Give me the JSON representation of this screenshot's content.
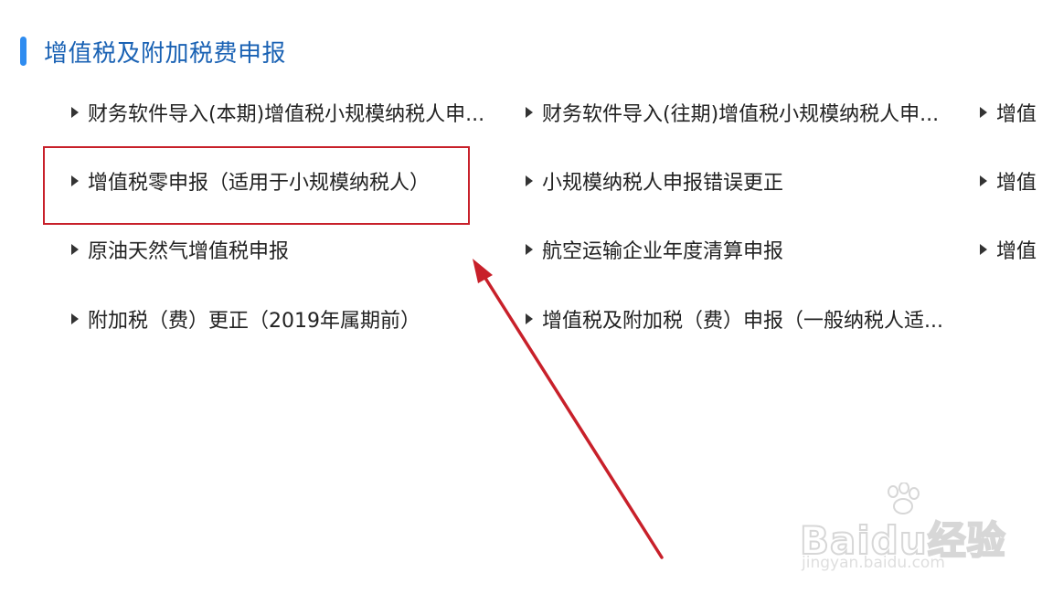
{
  "section": {
    "title": "增值税及附加税费申报"
  },
  "links": [
    {
      "label": "财务软件导入(本期)增值税小规模纳税人申..."
    },
    {
      "label": "财务软件导入(往期)增值税小规模纳税人申..."
    },
    {
      "label": "增值"
    },
    {
      "label": "增值税零申报（适用于小规模纳税人）"
    },
    {
      "label": "小规模纳税人申报错误更正"
    },
    {
      "label": "增值"
    },
    {
      "label": "原油天然气增值税申报"
    },
    {
      "label": "航空运输企业年度清算申报"
    },
    {
      "label": "增值"
    },
    {
      "label": "附加税（费）更正（2019年属期前）"
    },
    {
      "label": "增值税及附加税（费）申报（一般纳税人适..."
    }
  ],
  "annotation": {
    "box_color": "#c8202a",
    "arrow_color": "#c8202a"
  },
  "watermark": {
    "logo_text": "Baidu经验",
    "url_text": "jingyan.baidu.com"
  }
}
